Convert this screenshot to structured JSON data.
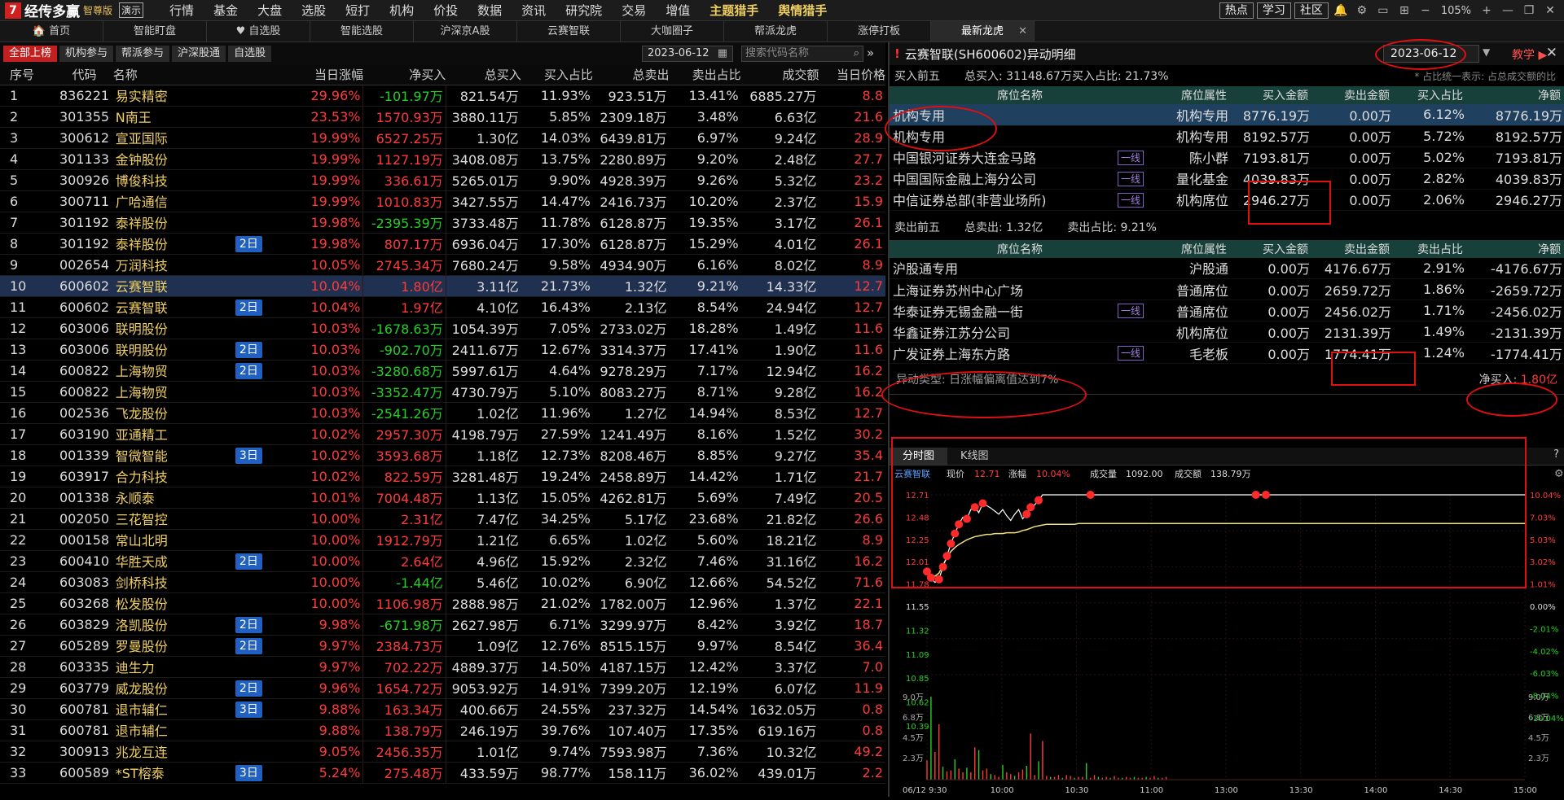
{
  "app": {
    "logo": "经传多赢",
    "edition": "智尊版",
    "demo": "演示"
  },
  "menu": [
    {
      "label": "行情",
      "dot": true
    },
    {
      "label": "基金"
    },
    {
      "label": "大盘"
    },
    {
      "label": "选股"
    },
    {
      "label": "短打"
    },
    {
      "label": "机构"
    },
    {
      "label": "价投"
    },
    {
      "label": "数据"
    },
    {
      "label": "资讯"
    },
    {
      "label": "研究院"
    },
    {
      "label": "交易"
    },
    {
      "label": "增值",
      "dot": true
    },
    {
      "label": "主题猎手",
      "dot": true,
      "gold": true
    },
    {
      "label": "舆情猎手",
      "dot": true,
      "gold": true
    }
  ],
  "top_right": {
    "buttons": [
      "热点",
      "学习",
      "社区"
    ],
    "zoom": "105%"
  },
  "tabs": [
    {
      "label": "🏠 首页"
    },
    {
      "label": "智能盯盘"
    },
    {
      "label": "♥ 自选股"
    },
    {
      "label": "智能选股"
    },
    {
      "label": "沪深京A股"
    },
    {
      "label": "云赛智联"
    },
    {
      "label": "大咖圈子"
    },
    {
      "label": "帮派龙虎"
    },
    {
      "label": "涨停打板"
    },
    {
      "label": "最新龙虎",
      "active": true
    }
  ],
  "left": {
    "subtabs": [
      "全部上榜",
      "机构参与",
      "帮派参与",
      "沪深股通",
      "自选股"
    ],
    "date": "2023-06-12",
    "search_placeholder": "搜索代码名称",
    "headers": [
      "序号",
      "代码",
      "名称",
      "当日涨幅",
      "净买入",
      "总买入",
      "买入占比",
      "总卖出",
      "卖出占比",
      "成交额",
      "当日价格"
    ],
    "rows": [
      [
        "1",
        "836221",
        "易实精密",
        "",
        "29.96%",
        "-101.97万",
        "821.54万",
        "11.93%",
        "923.51万",
        "13.41%",
        "6885.27万",
        "8.8"
      ],
      [
        "2",
        "301355",
        "N南王",
        "",
        "23.53%",
        "1570.93万",
        "3880.11万",
        "5.85%",
        "2309.18万",
        "3.48%",
        "6.63亿",
        "21.6"
      ],
      [
        "3",
        "300612",
        "宣亚国际",
        "",
        "19.99%",
        "6527.25万",
        "1.30亿",
        "14.03%",
        "6439.81万",
        "6.97%",
        "9.24亿",
        "28.9"
      ],
      [
        "4",
        "301133",
        "金钟股份",
        "",
        "19.99%",
        "1127.19万",
        "3408.08万",
        "13.75%",
        "2280.89万",
        "9.20%",
        "2.48亿",
        "27.7"
      ],
      [
        "5",
        "300926",
        "博俊科技",
        "",
        "19.99%",
        "336.61万",
        "5265.01万",
        "9.90%",
        "4928.39万",
        "9.26%",
        "5.32亿",
        "23.2"
      ],
      [
        "6",
        "300711",
        "广哈通信",
        "",
        "19.99%",
        "1010.83万",
        "3427.55万",
        "14.47%",
        "2416.73万",
        "10.20%",
        "2.37亿",
        "15.9"
      ],
      [
        "7",
        "301192",
        "泰祥股份",
        "",
        "19.98%",
        "-2395.39万",
        "3733.48万",
        "11.78%",
        "6128.87万",
        "19.35%",
        "3.17亿",
        "26.1"
      ],
      [
        "8",
        "301192",
        "泰祥股份",
        "2日",
        "19.98%",
        "807.17万",
        "6936.04万",
        "17.30%",
        "6128.87万",
        "15.29%",
        "4.01亿",
        "26.1"
      ],
      [
        "9",
        "002654",
        "万润科技",
        "",
        "10.05%",
        "2745.34万",
        "7680.24万",
        "9.58%",
        "4934.90万",
        "6.16%",
        "8.02亿",
        "8.9"
      ],
      [
        "10",
        "600602",
        "云赛智联",
        "",
        "10.04%",
        "1.80亿",
        "3.11亿",
        "21.73%",
        "1.32亿",
        "9.21%",
        "14.33亿",
        "12.7"
      ],
      [
        "11",
        "600602",
        "云赛智联",
        "2日",
        "10.04%",
        "1.97亿",
        "4.10亿",
        "16.43%",
        "2.13亿",
        "8.54%",
        "24.94亿",
        "12.7"
      ],
      [
        "12",
        "603006",
        "联明股份",
        "",
        "10.03%",
        "-1678.63万",
        "1054.39万",
        "7.05%",
        "2733.02万",
        "18.28%",
        "1.49亿",
        "11.6"
      ],
      [
        "13",
        "603006",
        "联明股份",
        "2日",
        "10.03%",
        "-902.70万",
        "2411.67万",
        "12.67%",
        "3314.37万",
        "17.41%",
        "1.90亿",
        "11.6"
      ],
      [
        "14",
        "600822",
        "上海物贸",
        "2日",
        "10.03%",
        "-3280.68万",
        "5997.61万",
        "4.64%",
        "9278.29万",
        "7.17%",
        "12.94亿",
        "16.2"
      ],
      [
        "15",
        "600822",
        "上海物贸",
        "",
        "10.03%",
        "-3352.47万",
        "4730.79万",
        "5.10%",
        "8083.27万",
        "8.71%",
        "9.28亿",
        "16.2"
      ],
      [
        "16",
        "002536",
        "飞龙股份",
        "",
        "10.03%",
        "-2541.26万",
        "1.02亿",
        "11.96%",
        "1.27亿",
        "14.94%",
        "8.53亿",
        "12.7"
      ],
      [
        "17",
        "603190",
        "亚通精工",
        "",
        "10.02%",
        "2957.30万",
        "4198.79万",
        "27.59%",
        "1241.49万",
        "8.16%",
        "1.52亿",
        "30.2"
      ],
      [
        "18",
        "001339",
        "智微智能",
        "3日",
        "10.02%",
        "3593.68万",
        "1.18亿",
        "12.73%",
        "8208.46万",
        "8.85%",
        "9.27亿",
        "35.4"
      ],
      [
        "19",
        "603917",
        "合力科技",
        "",
        "10.02%",
        "822.59万",
        "3281.48万",
        "19.24%",
        "2458.89万",
        "14.42%",
        "1.71亿",
        "21.7"
      ],
      [
        "20",
        "001338",
        "永顺泰",
        "",
        "10.01%",
        "7004.48万",
        "1.13亿",
        "15.05%",
        "4262.81万",
        "5.69%",
        "7.49亿",
        "20.5"
      ],
      [
        "21",
        "002050",
        "三花智控",
        "",
        "10.00%",
        "2.31亿",
        "7.47亿",
        "34.25%",
        "5.17亿",
        "23.68%",
        "21.82亿",
        "26.6"
      ],
      [
        "22",
        "000158",
        "常山北明",
        "",
        "10.00%",
        "1912.79万",
        "1.21亿",
        "6.65%",
        "1.02亿",
        "5.60%",
        "18.21亿",
        "8.9"
      ],
      [
        "23",
        "600410",
        "华胜天成",
        "2日",
        "10.00%",
        "2.64亿",
        "4.96亿",
        "15.92%",
        "2.32亿",
        "7.46%",
        "31.16亿",
        "16.2"
      ],
      [
        "24",
        "603083",
        "剑桥科技",
        "",
        "10.00%",
        "-1.44亿",
        "5.46亿",
        "10.02%",
        "6.90亿",
        "12.66%",
        "54.52亿",
        "71.6"
      ],
      [
        "25",
        "603268",
        "松发股份",
        "",
        "10.00%",
        "1106.98万",
        "2888.98万",
        "21.02%",
        "1782.00万",
        "12.96%",
        "1.37亿",
        "22.1"
      ],
      [
        "26",
        "603829",
        "洛凯股份",
        "2日",
        "9.98%",
        "-671.98万",
        "2627.98万",
        "6.71%",
        "3299.97万",
        "8.42%",
        "3.92亿",
        "18.7"
      ],
      [
        "27",
        "605289",
        "罗曼股份",
        "2日",
        "9.97%",
        "2384.73万",
        "1.09亿",
        "12.76%",
        "8515.15万",
        "9.97%",
        "8.54亿",
        "36.4"
      ],
      [
        "28",
        "603335",
        "迪生力",
        "",
        "9.97%",
        "702.22万",
        "4889.37万",
        "14.50%",
        "4187.15万",
        "12.42%",
        "3.37亿",
        "7.0"
      ],
      [
        "29",
        "603779",
        "威龙股份",
        "2日",
        "9.96%",
        "1654.72万",
        "9053.92万",
        "14.91%",
        "7399.20万",
        "12.19%",
        "6.07亿",
        "11.9"
      ],
      [
        "30",
        "600781",
        "退市辅仁",
        "3日",
        "9.88%",
        "163.34万",
        "400.66万",
        "24.55%",
        "237.32万",
        "14.54%",
        "1632.05万",
        "0.8"
      ],
      [
        "31",
        "600781",
        "退市辅仁",
        "",
        "9.88%",
        "138.79万",
        "246.19万",
        "39.76%",
        "107.40万",
        "17.35%",
        "619.16万",
        "0.8"
      ],
      [
        "32",
        "300913",
        "兆龙互连",
        "",
        "9.05%",
        "2456.35万",
        "1.01亿",
        "9.74%",
        "7593.98万",
        "7.36%",
        "10.32亿",
        "49.2"
      ],
      [
        "33",
        "600589",
        "*ST榕泰",
        "3日",
        "5.24%",
        "275.48万",
        "433.59万",
        "98.77%",
        "158.11万",
        "36.02%",
        "439.01万",
        "2.2"
      ]
    ]
  },
  "right": {
    "title": "云赛智联(SH600602)异动明细",
    "date": "2023-06-12",
    "teach": "教学",
    "buy": {
      "label": "买入前五",
      "total": "总买入: 31148.67万",
      "ratio": "买入占比: 21.73%",
      "note": "* 占比统一表示: 占总成交额的比",
      "headers": [
        "席位名称",
        "席位属性",
        "买入金额",
        "卖出金额",
        "买入占比",
        "净额"
      ],
      "rows": [
        {
          "name": "机构专用",
          "tag": "",
          "attr": "机构专用",
          "buy": "8776.19万",
          "sell": "0.00万",
          "ratio": "6.12%",
          "net": "8776.19万"
        },
        {
          "name": "机构专用",
          "tag": "",
          "attr": "机构专用",
          "buy": "8192.57万",
          "sell": "0.00万",
          "ratio": "5.72%",
          "net": "8192.57万"
        },
        {
          "name": "中国银河证券大连金马路",
          "tag": "一线",
          "attr": "陈小群",
          "buy": "7193.81万",
          "sell": "0.00万",
          "ratio": "5.02%",
          "net": "7193.81万"
        },
        {
          "name": "中国国际金融上海分公司",
          "tag": "一线",
          "attr": "量化基金",
          "buy": "4039.83万",
          "sell": "0.00万",
          "ratio": "2.82%",
          "net": "4039.83万"
        },
        {
          "name": "中信证券总部(非营业场所)",
          "tag": "一线",
          "attr": "机构席位",
          "buy": "2946.27万",
          "sell": "0.00万",
          "ratio": "2.06%",
          "net": "2946.27万"
        }
      ]
    },
    "sell": {
      "label": "卖出前五",
      "total": "总卖出: 1.32亿",
      "ratio": "卖出占比: 9.21%",
      "headers": [
        "席位名称",
        "席位属性",
        "买入金额",
        "卖出金额",
        "卖出占比",
        "净额"
      ],
      "rows": [
        {
          "name": "沪股通专用",
          "tag": "",
          "attr": "沪股通",
          "buy": "0.00万",
          "sell": "4176.67万",
          "ratio": "2.91%",
          "net": "-4176.67万"
        },
        {
          "name": "上海证券苏州中心广场",
          "tag": "",
          "attr": "普通席位",
          "buy": "0.00万",
          "sell": "2659.72万",
          "ratio": "1.86%",
          "net": "-2659.72万"
        },
        {
          "name": "华泰证券无锡金融一街",
          "tag": "一线",
          "attr": "普通席位",
          "buy": "0.00万",
          "sell": "2456.02万",
          "ratio": "1.71%",
          "net": "-2456.02万"
        },
        {
          "name": "华鑫证券江苏分公司",
          "tag": "",
          "attr": "机构席位",
          "buy": "0.00万",
          "sell": "2131.39万",
          "ratio": "1.49%",
          "net": "-2131.39万"
        },
        {
          "name": "广发证券上海东方路",
          "tag": "一线",
          "attr": "毛老板",
          "buy": "0.00万",
          "sell": "1774.41万",
          "ratio": "1.24%",
          "net": "-1774.41万"
        }
      ]
    },
    "abnormal_type": "异动类型: 日涨幅偏离值达到7%",
    "net_buy_label": "净买入:",
    "net_buy_value": "1.80亿",
    "chart_tabs": [
      "分时图",
      "K线图"
    ],
    "chart_info": {
      "name": "云赛智联",
      "price_label": "现价",
      "price": "12.71",
      "change_label": "涨幅",
      "change": "10.04%",
      "vol_label": "成交量",
      "vol": "1092.00",
      "amt_label": "成交额",
      "amt": "138.79万"
    }
  },
  "chart_data": {
    "type": "line",
    "price_ticks": [
      "12.71",
      "12.48",
      "12.25",
      "12.01",
      "11.78",
      "11.55",
      "11.32",
      "11.09",
      "10.85",
      "10.62",
      "10.39"
    ],
    "pct_ticks": [
      "10.04%",
      "7.03%",
      "5.03%",
      "3.02%",
      "1.01%",
      "0.00%",
      "-2.01%",
      "-4.02%",
      "-6.03%",
      "-8.04%",
      "-10.04%"
    ],
    "vol_ticks": [
      "9.0万",
      "6.8万",
      "4.5万",
      "2.3万"
    ],
    "time_ticks": [
      "06/12 9:30",
      "10:00",
      "10:30",
      "11:00",
      "13:00",
      "13:30",
      "14:00",
      "14:30",
      "15:00"
    ],
    "ylim": [
      10.39,
      12.71
    ],
    "price": [
      11.72,
      11.64,
      11.58,
      11.62,
      11.78,
      11.92,
      12.08,
      12.21,
      12.33,
      12.42,
      12.4,
      12.52,
      12.55,
      12.48,
      12.6,
      12.57,
      12.54,
      12.5,
      12.46,
      12.52,
      12.44,
      12.38,
      12.46,
      12.52,
      12.4,
      12.46,
      12.55,
      12.58,
      12.64,
      12.71,
      12.71,
      12.71,
      12.71,
      12.71,
      12.71,
      12.71,
      12.71,
      12.71,
      12.71,
      12.71,
      12.71,
      12.71,
      12.71,
      12.71,
      12.71,
      12.71,
      12.71,
      12.71,
      12.71,
      12.71,
      12.71,
      12.71,
      12.71,
      12.71,
      12.71,
      12.71,
      12.71,
      12.71,
      12.71,
      12.71,
      12.71
    ],
    "avg": [
      11.72,
      11.68,
      11.66,
      11.7,
      11.8,
      11.9,
      11.98,
      12.03,
      12.07,
      12.1,
      12.13,
      12.15,
      12.17,
      12.18,
      12.19,
      12.2,
      12.2,
      12.21,
      12.21,
      12.21,
      12.22,
      12.22,
      12.22,
      12.23,
      12.25,
      12.26,
      12.28,
      12.3,
      12.31,
      12.32,
      12.33,
      12.33,
      12.33,
      12.33,
      12.33,
      12.33,
      12.33,
      12.33,
      12.34,
      12.34,
      12.34,
      12.34,
      12.34,
      12.34,
      12.34,
      12.34,
      12.34,
      12.34,
      12.34,
      12.34,
      12.34,
      12.34,
      12.34,
      12.34,
      12.34,
      12.34,
      12.34,
      12.34,
      12.34,
      12.34,
      12.34
    ],
    "marks": [
      0,
      1,
      3,
      4,
      5,
      6,
      7,
      8,
      10,
      12,
      14,
      25,
      26,
      28,
      41
    ],
    "volume": [
      2.1,
      9.0,
      3.0,
      6.0,
      1.4,
      0.9,
      1.0,
      2.2,
      1.2,
      0.8,
      1.3,
      0.8,
      3.5,
      3.2,
      1.0,
      1.2,
      0.6,
      0.5,
      0.3,
      1.6,
      0.8,
      0.6,
      0.4,
      0.8,
      1.1,
      1.5,
      5.0,
      0.5,
      2.0,
      4.2,
      0.4,
      0.3,
      0.3,
      0.5,
      0.2,
      0.5,
      0.4,
      0.2,
      0.3,
      0.3,
      1.8,
      0.2,
      0.5,
      0.3,
      0.2,
      0.3,
      0.2,
      0.4,
      0.2,
      0.2,
      0.3,
      0.2,
      0.3,
      0.2,
      0.2,
      0.3,
      0.2,
      0.4,
      0.2,
      0.2,
      0.3
    ]
  }
}
